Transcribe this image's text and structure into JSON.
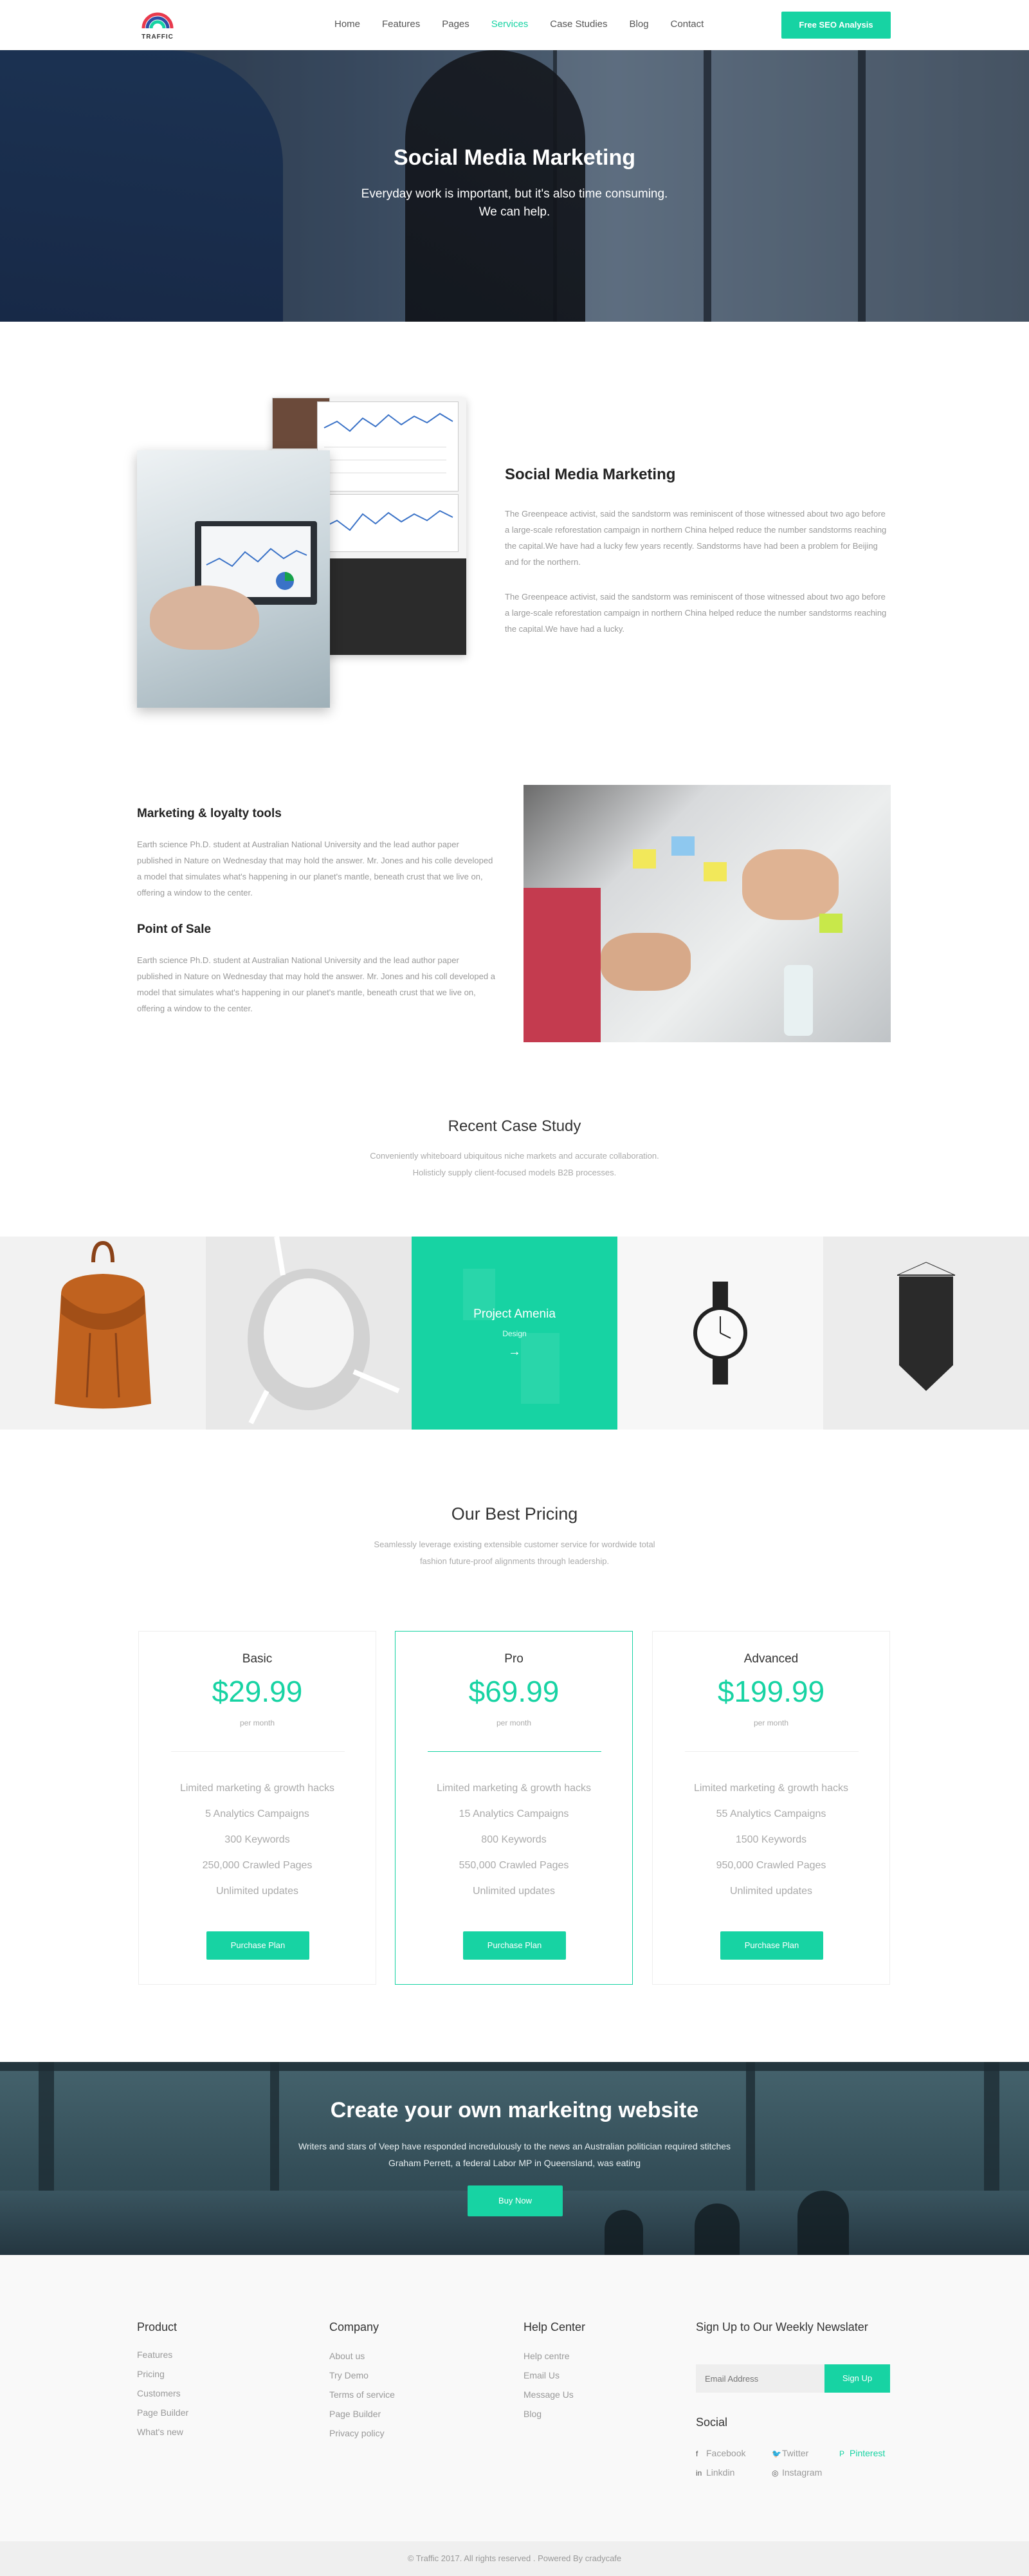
{
  "header": {
    "logo_text": "TRAFFIC",
    "nav": [
      "Home",
      "Features",
      "Pages",
      "Services",
      "Case Studies",
      "Blog",
      "Contact"
    ],
    "active_nav": "Services",
    "cta_label": "Free SEO Analysis"
  },
  "hero": {
    "title": "Social Media Marketing",
    "subtitle_line1": "Everyday work is important, but it's also time consuming.",
    "subtitle_line2": "We can help."
  },
  "intro": {
    "title": "Social Media Marketing",
    "para1": "The Greenpeace activist, said the sandstorm was reminiscent of those witnessed about two ago before a large-scale reforestation campaign in northern China helped reduce the number sandstorms reaching the capital.We have had a lucky few years recently. Sandstorms have had been a problem for Beijing and for the northern.",
    "para2": "The Greenpeace activist, said the sandstorm was reminiscent of those witnessed about two ago before a large-scale reforestation campaign in northern China helped reduce the number sandstorms reaching the capital.We have had a lucky."
  },
  "features": {
    "h1": "Marketing & loyalty tools",
    "p1": "Earth science Ph.D. student at Australian National University and the lead author paper published in Nature on Wednesday that may hold the answer. Mr. Jones and his colle developed a model that simulates what's happening in our planet's mantle, beneath crust that we live on, offering a window to the center.",
    "h2": "Point of Sale",
    "p2": "Earth science Ph.D. student at Australian National University and the lead author paper published in Nature on Wednesday that may hold the answer. Mr. Jones and his coll developed a model that simulates what's happening in our planet's mantle, beneath crust that we live on, offering a window to the center."
  },
  "case_study": {
    "title": "Recent Case Study",
    "sub1": "Conveniently whiteboard ubiquitous niche markets and accurate collaboration.",
    "sub2": "Holisticly supply client-focused models B2B processes.",
    "active_tile_title": "Project Amenia",
    "active_tile_sub": "Design",
    "active_tile_arrow": "→",
    "tiles": [
      "backpack",
      "chair",
      "project-amenia",
      "watch",
      "pennant"
    ]
  },
  "pricing": {
    "title": "Our Best Pricing",
    "sub1": "Seamlessly leverage existing extensible customer service for wordwide total",
    "sub2": "fashion future-proof alignments through leadership.",
    "plans": [
      {
        "name": "Basic",
        "price": "$29.99",
        "per": "per month",
        "features": [
          "Limited marketing & growth hacks",
          "5 Analytics Campaigns",
          "300 Keywords",
          "250,000 Crawled Pages",
          "Unlimited updates"
        ],
        "button": "Purchase Plan"
      },
      {
        "name": "Pro",
        "price": "$69.99",
        "per": "per month",
        "features": [
          "Limited marketing & growth hacks",
          "15 Analytics Campaigns",
          "800 Keywords",
          "550,000 Crawled Pages",
          "Unlimited updates"
        ],
        "button": "Purchase Plan"
      },
      {
        "name": "Advanced",
        "price": "$199.99",
        "per": "per month",
        "features": [
          "Limited marketing & growth hacks",
          "55 Analytics Campaigns",
          "1500 Keywords",
          "950,000 Crawled Pages",
          "Unlimited updates"
        ],
        "button": "Purchase Plan"
      }
    ]
  },
  "banner": {
    "title": "Create your own markeitng website",
    "line1": "Writers and stars of Veep have responded incredulously to the news an Australian politician required stitches",
    "line2": "Graham Perrett, a federal Labor MP in Queensland, was eating",
    "button": "Buy Now"
  },
  "footer": {
    "product": {
      "title": "Product",
      "links": [
        "Features",
        "Pricing",
        "Customers",
        "Page Builder",
        "What's new"
      ]
    },
    "company": {
      "title": "Company",
      "links": [
        "About us",
        "Try Demo",
        "Terms of service",
        "Page Builder",
        "Privacy policy"
      ]
    },
    "help": {
      "title": "Help Center",
      "links": [
        "Help centre",
        "Email Us",
        "Message Us",
        "Blog"
      ]
    },
    "newsletter": {
      "title": "Sign Up to Our Weekly Newslater",
      "placeholder": "Email Address",
      "button": "Sign Up"
    },
    "social": {
      "title": "Social",
      "links": [
        "Facebook",
        "Twitter",
        "Pinterest",
        "Linkdin",
        "Instagram"
      ],
      "icons": [
        "f",
        "🐦",
        "P",
        "in",
        "◎"
      ]
    },
    "copyright": "© Traffic 2017. All rights reserved . Powered By cradycafe"
  },
  "colors": {
    "accent": "#17d3a3"
  }
}
